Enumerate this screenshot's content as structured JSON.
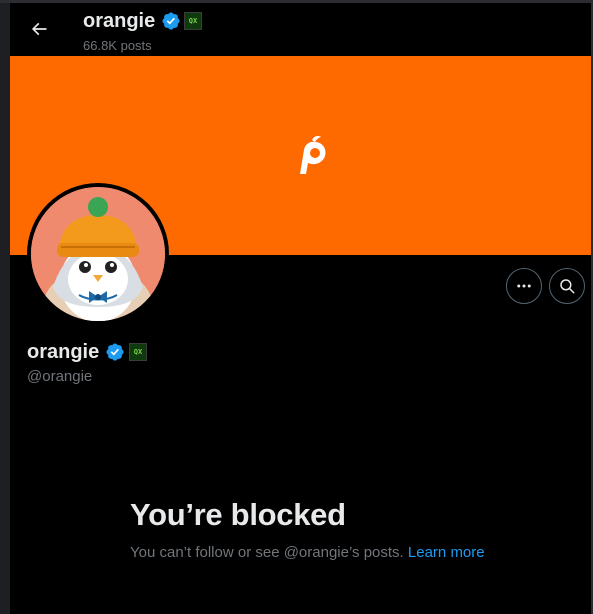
{
  "header": {
    "name": "orangie",
    "posts_count": "66.8K posts",
    "affiliate_badge_text": "QX"
  },
  "profile": {
    "display_name": "orangie",
    "handle": "@orangie"
  },
  "blocked": {
    "title": "You’re blocked",
    "message": "You can’t follow or see @orangie’s posts.",
    "link_label": "Learn more"
  },
  "icons": {
    "back": "arrow-left-icon",
    "verified": "verified-badge-icon",
    "more": "more-horizontal-icon",
    "search": "search-icon"
  },
  "colors": {
    "banner": "#ff6a00",
    "link": "#1d9bf0",
    "verified": "#1d9bf0",
    "background": "#000000",
    "muted_text": "#71767b"
  }
}
